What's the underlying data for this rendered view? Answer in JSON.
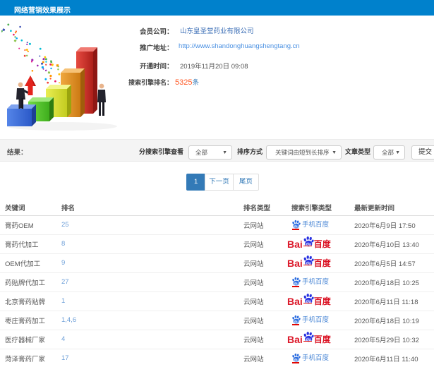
{
  "header": {
    "title": "网络营销效果展示",
    "bg": "#0081cc"
  },
  "info": {
    "rows": [
      {
        "label": "会员公司：",
        "value": "山东皇圣堂药业有限公司",
        "kind": "company"
      },
      {
        "label": "推广地址：",
        "value": "http://www.shandonghuangshengtang.cn",
        "kind": "url"
      },
      {
        "label": "开通时间：",
        "value": "2019年11月20日 09:08",
        "kind": "plain"
      },
      {
        "label": "搜索引擎排名：",
        "value_num": "5325",
        "value_unit": "条",
        "kind": "count"
      }
    ]
  },
  "filter": {
    "result_label": "结果：",
    "engine_label": "分搜索引擎查看",
    "engine_value": "全部",
    "sort_label": "排序方式",
    "sort_value": "关键词由短到长排序",
    "article_label": "文章类型",
    "article_value": "全部",
    "submit_label": "提交"
  },
  "pager": {
    "current": "1",
    "next": "下一页",
    "last": "尾页"
  },
  "table": {
    "headers": [
      "关键词",
      "排名",
      "排名类型",
      "搜索引擎类型",
      "最新更新时间"
    ],
    "engine_names": {
      "mobile": "手机百度",
      "pc": "百度"
    },
    "pc_logo_parts": {
      "bai": "Bai",
      "du": "du",
      "baidu": "百度"
    },
    "rows": [
      {
        "keyword": "膏药OEM",
        "rank": "25",
        "rank_type": "云网站",
        "engine": "mobile",
        "updated": "2020年6月9日 17:50"
      },
      {
        "keyword": "膏药代加工",
        "rank": "8",
        "rank_type": "云网站",
        "engine": "pc",
        "updated": "2020年6月10日 13:40"
      },
      {
        "keyword": "OEM代加工",
        "rank": "9",
        "rank_type": "云网站",
        "engine": "pc",
        "updated": "2020年6月5日 14:57"
      },
      {
        "keyword": "药贴牌代加工",
        "rank": "27",
        "rank_type": "云网站",
        "engine": "mobile",
        "updated": "2020年6月18日 10:25"
      },
      {
        "keyword": "北京膏药贴牌",
        "rank": "1",
        "rank_type": "云网站",
        "engine": "pc",
        "updated": "2020年6月11日 11:18"
      },
      {
        "keyword": "枣庄膏药加工",
        "rank": "1,4,6",
        "rank_type": "云网站",
        "engine": "mobile",
        "updated": "2020年6月18日 10:19"
      },
      {
        "keyword": "医疗器械厂家",
        "rank": "4",
        "rank_type": "云网站",
        "engine": "pc",
        "updated": "2020年5月29日 10:32"
      },
      {
        "keyword": "菏泽膏药厂家",
        "rank": "17",
        "rank_type": "云网站",
        "engine": "mobile",
        "updated": "2020年6月11日 11:40"
      }
    ]
  },
  "colors": {
    "header_bg": "#0081cc",
    "link": "#3a6db5",
    "url": "#4a90e2",
    "count": "#ff5b28",
    "pager_active": "#337ab7",
    "baidu_red": "#dc1b2c",
    "baidu_blue": "#2932e1",
    "rank_link": "#6d9fd8"
  }
}
